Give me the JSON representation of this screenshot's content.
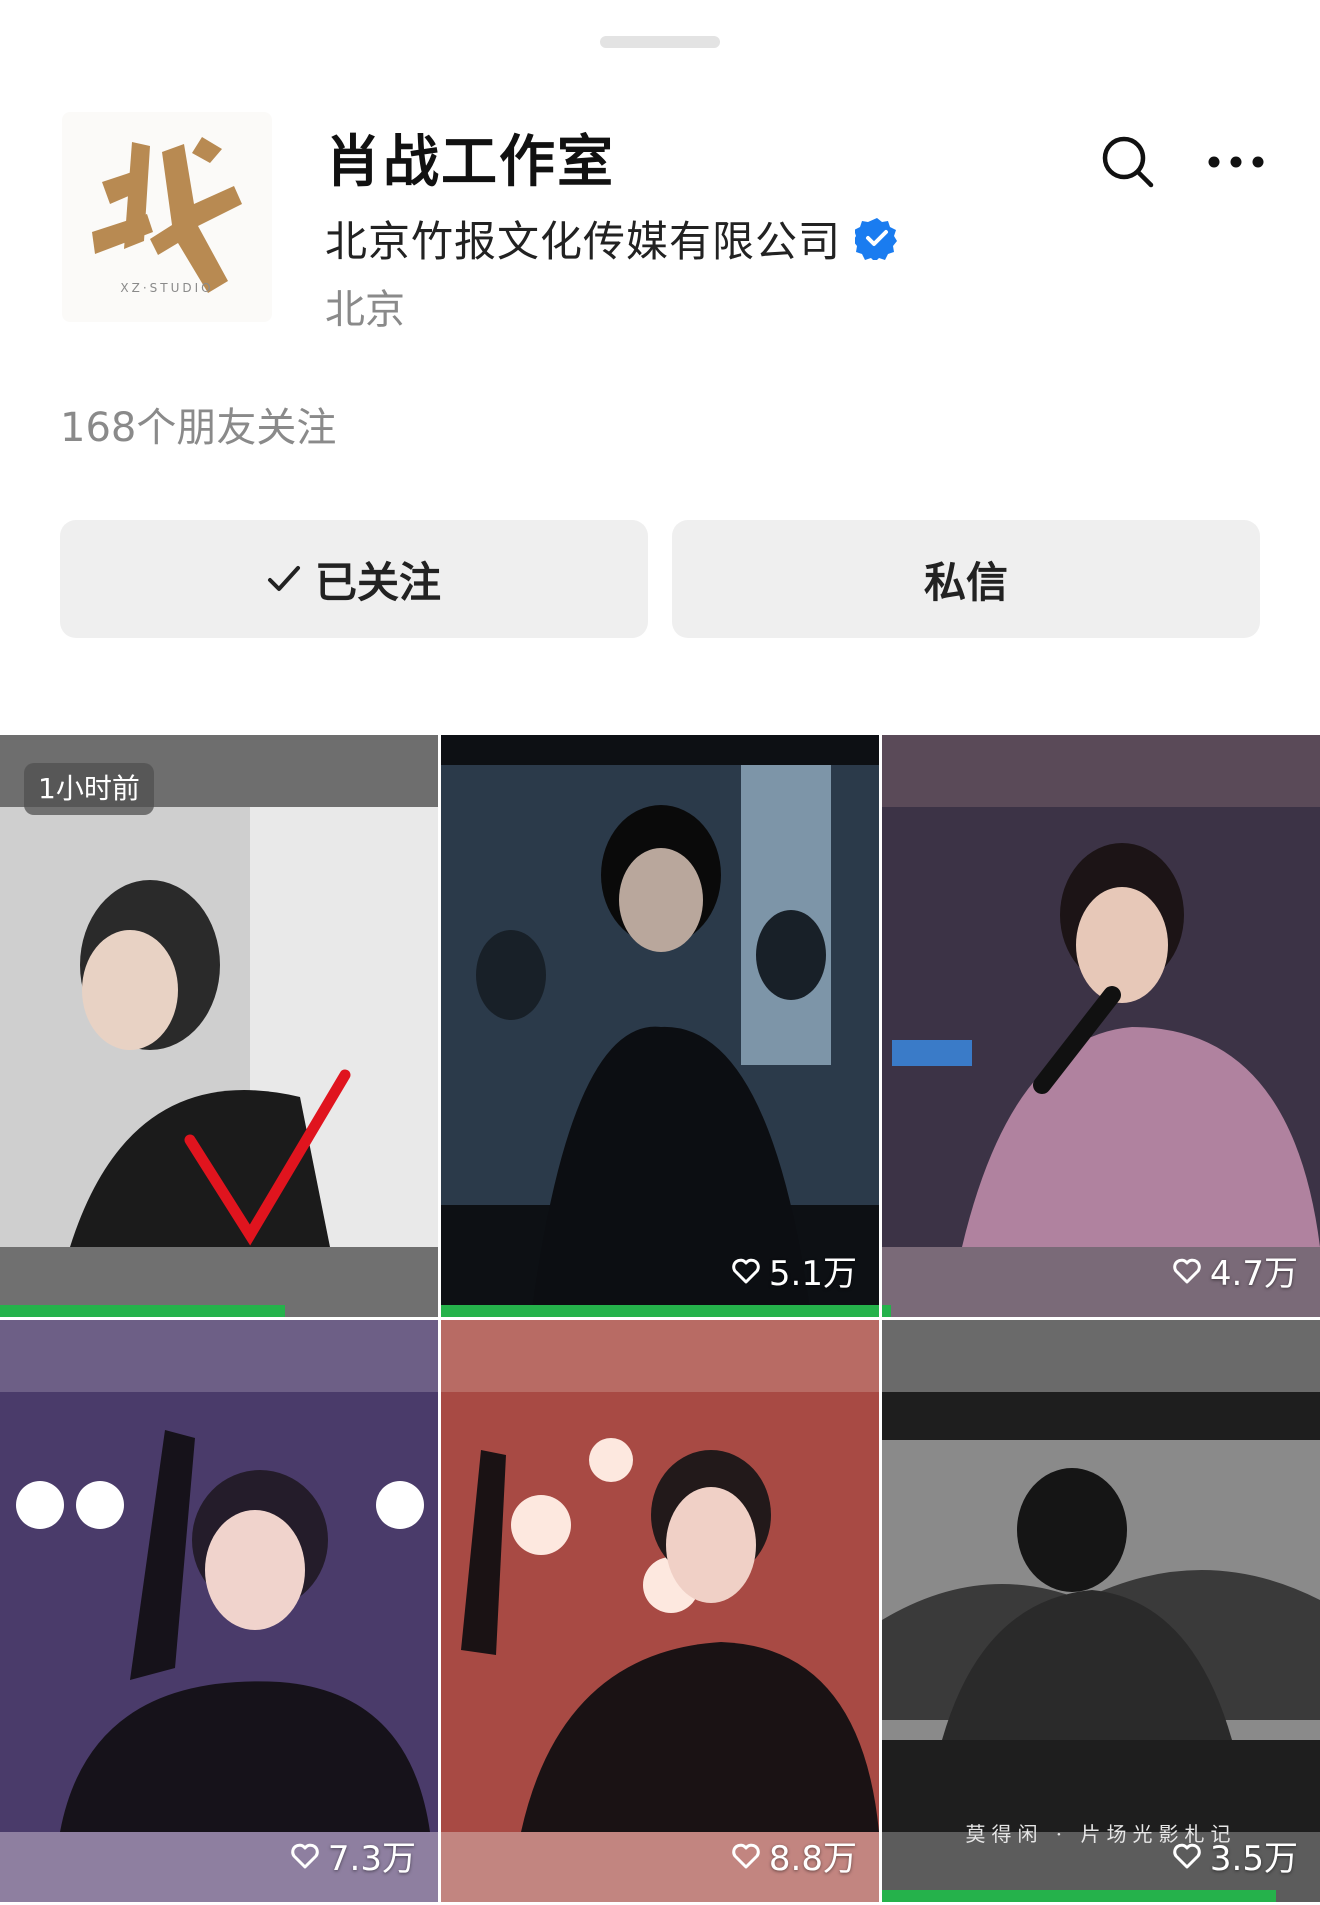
{
  "profile": {
    "name": "肖战工作室",
    "company": "北京竹报文化传媒有限公司",
    "location": "北京",
    "friends_following": "168个朋友关注",
    "avatar_icon": "xz-studio-logo",
    "verified_color": "#1a7cf0"
  },
  "actions": {
    "follow_label": "已关注",
    "message_label": "私信"
  },
  "videos": [
    {
      "badge": "1小时前",
      "likes": "",
      "progress": 0.65
    },
    {
      "badge": "",
      "likes": "5.1万",
      "progress": 1.0
    },
    {
      "badge": "",
      "likes": "4.7万",
      "progress": 0.02
    },
    {
      "badge": "",
      "likes": "7.3万",
      "progress": 0
    },
    {
      "badge": "",
      "likes": "8.8万",
      "progress": 0
    },
    {
      "badge": "",
      "likes": "3.5万",
      "caption": "莫得闲 · 片场光影札记",
      "progress": 0.9
    }
  ],
  "colors": {
    "progress": "#25b24b",
    "button_bg": "#efefef"
  }
}
